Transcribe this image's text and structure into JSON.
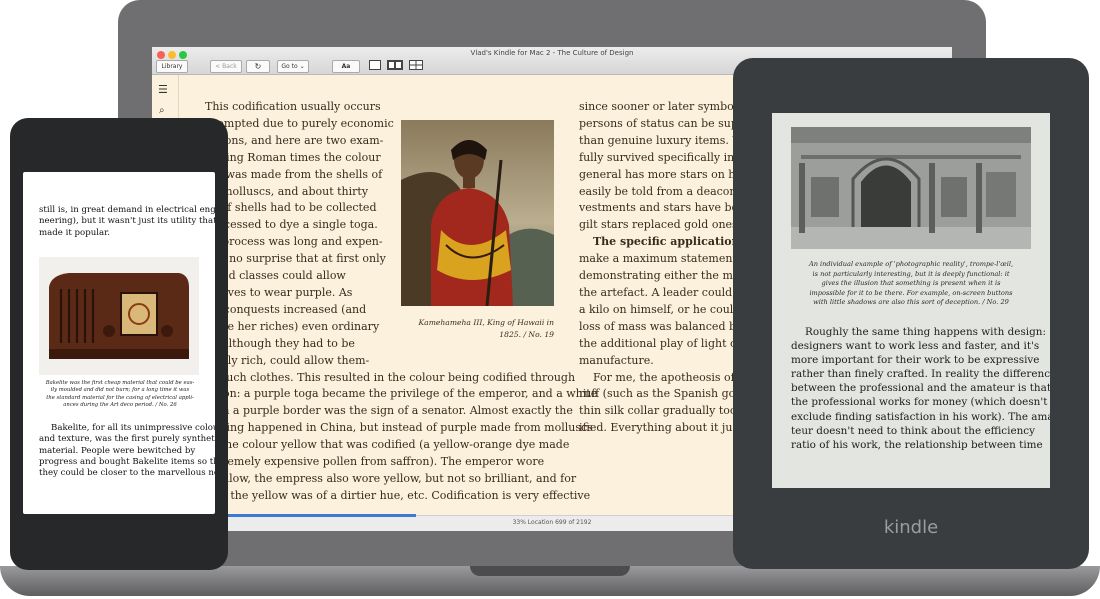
{
  "window": {
    "title": "Vlad's Kindle for Mac 2 - The Culture of Design",
    "library_label": "Library",
    "back_label": "< Back",
    "goto_label": "Go to ⌄",
    "font_label": "Aa",
    "status_text": "33%    Location 699 of 2192",
    "progress": 0.33,
    "colors": {
      "page_bg": "#fbf1dd",
      "progress": "#3d7bd0"
    }
  },
  "reader": {
    "left_lines": [
      "This codification usually occurs",
      "prompted due to purely economic",
      "rations, and here are two exam-",
      "During Roman times the colour",
      "ple was made from the shells of",
      "ne molluscs, and about thirty",
      "es of shells had to be collected",
      "processed to dye a single toga.",
      "he process was long and expen-",
      "it is no surprise that at first only",
      "leged classes could allow",
      "nselves to wear purple. As",
      "e's conquests increased (and",
      "efore her riches) even ordinary",
      "le, although they had to be",
      "sually rich, could allow them-",
      "es such clothes. This resulted in the colour being codified through",
      "lation: a purple toga became the privilege of the emperor, and a white",
      "with a purple border was the sign of a senator. Almost exactly the",
      "e thing happened in China, but instead of purple made from molluscs",
      "as the colour yellow that was codified (a yellow-orange dye made",
      "extremely expensive pollen from saffron). The emperor wore",
      "t yellow, the empress also wore yellow, but not so brilliant, and for",
      "ives the yellow was of a dirtier hue, etc. Codification is very effective"
    ],
    "caption_lines": [
      "Kamehameha III, King of Hawaii in",
      "1825. / No. 19"
    ],
    "right_lines": [
      "since sooner or later symbols of s",
      "persons of status can be supplied",
      "than genuine luxury items. We c",
      "fully survived specifically in the",
      "general has more stars on his ep",
      "easily be told from a deacon thro",
      "vestments and stars have been r",
      "gilt stars replaced gold ones a lo",
      "The specific application of th",
      "make a maximum statement abo",
      "demonstrating either the materi",
      "the artefact. A leader could, for i",
      "a kilo on himself, or he could pu",
      "loss of mass was balanced by the",
      "the additional play of light on the",
      "manufacture.",
      "For me, the apotheosis of this",
      "ruff (such as the Spanish gorgue",
      "thin silk collar gradually took on",
      "ified. Everything about it just sho"
    ]
  },
  "phone": {
    "top_lines": [
      "still is, in great demand in electrical engi-",
      "neering), but it wasn't just its utility that",
      "made it popular."
    ],
    "caption_lines": [
      "Bakelite was the first cheap material that could be eas-",
      "ily moulded and did not burn; for a long time it was",
      "the standard material for the casing of electrical appli-",
      "ances during the Art deco period. / No. 26"
    ],
    "body_lines": [
      "Bakelite, for all its unimpressive colour",
      "and texture, was the first purely synthetic",
      "material. People were bewitched by",
      "progress and bought Bakelite items so that",
      "they could be closer to the marvellous new"
    ]
  },
  "kindle": {
    "brand": "kindle",
    "caption_lines": [
      "An individual example of 'photographic reality', trompe-l'œil,",
      "is not particularly interesting, but it is deeply functional: it",
      "gives the illusion that something is present when it is",
      "impossible for it to be there. For example, on-screen buttons",
      "with little shadows are also this sort of deception. / No. 29"
    ],
    "body_lines": [
      "Roughly the same thing happens with design:",
      "designers want to work less and faster, and it's",
      "more important for their work to be expressive",
      "rather than finely crafted. In reality the difference",
      "between the professional and the amateur is that",
      "the professional works for money (which doesn't",
      "exclude finding satisfaction in his work). The ama-",
      "teur doesn't need to think about the efficiency",
      "ratio of his work, the relationship between time"
    ]
  }
}
